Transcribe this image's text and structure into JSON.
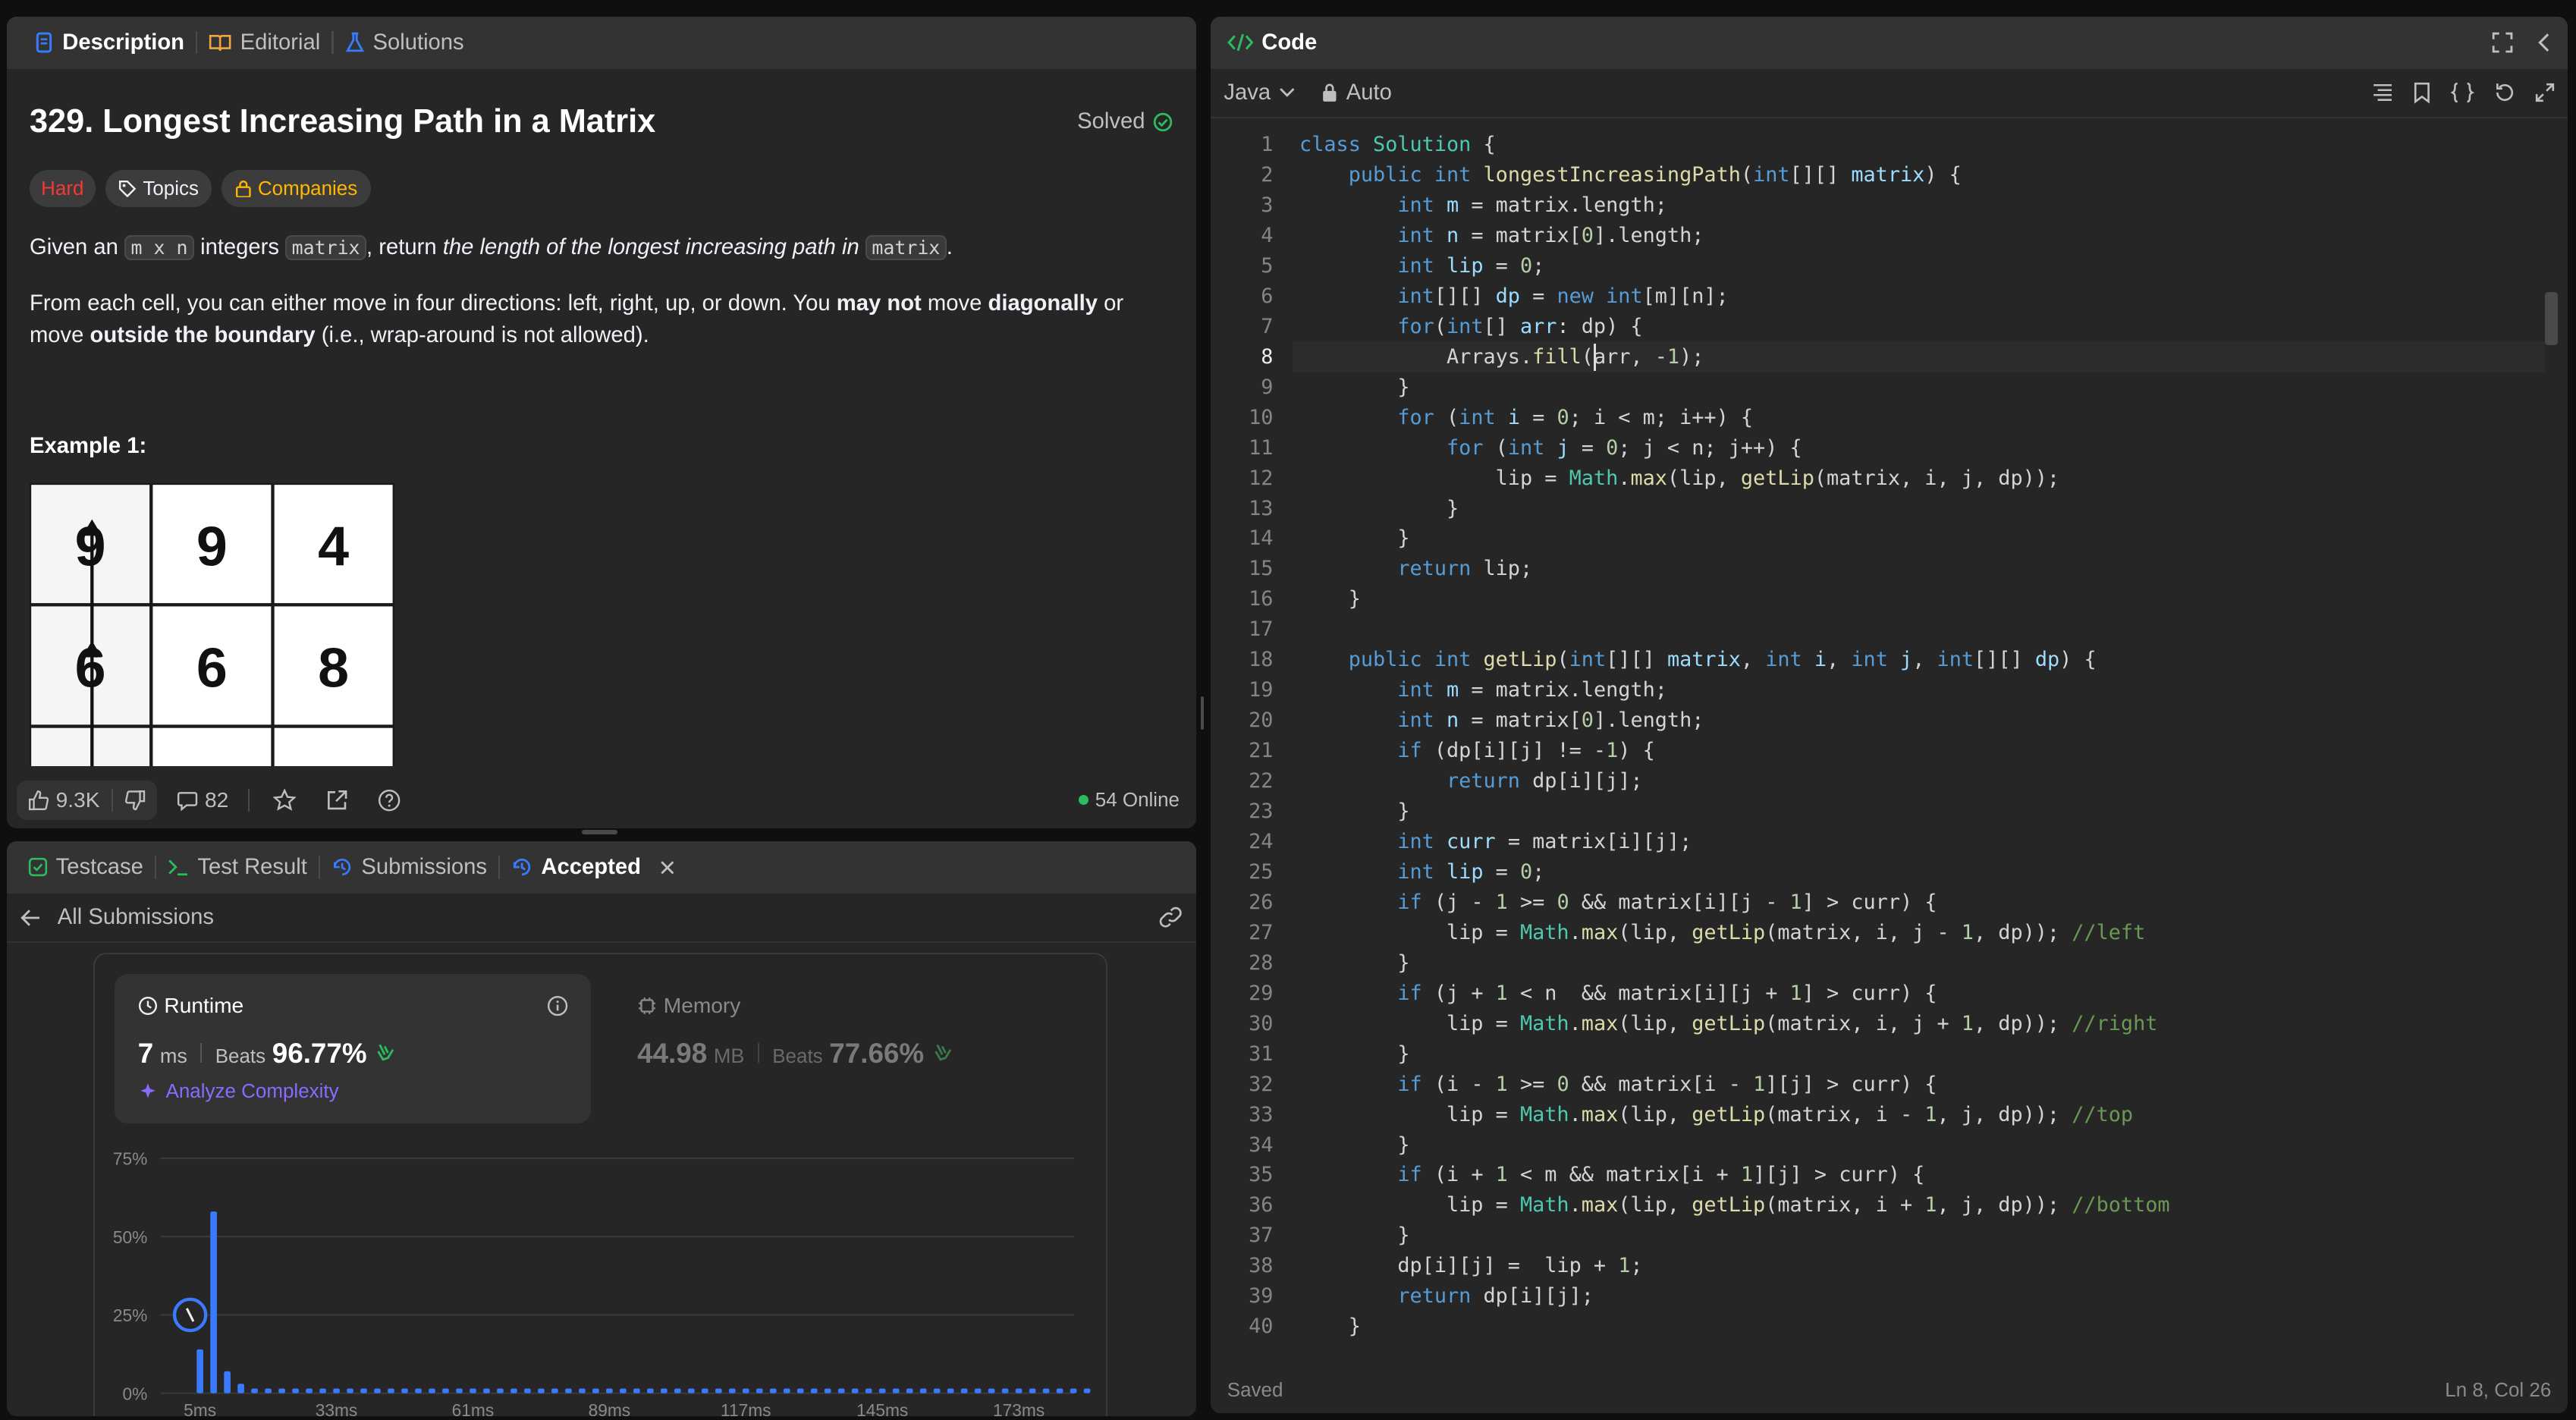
{
  "left_tabs": {
    "description": "Description",
    "editorial": "Editorial",
    "solutions": "Solutions"
  },
  "problem": {
    "title": "329. Longest Increasing Path in a Matrix",
    "solved": "Solved",
    "difficulty": "Hard",
    "topics": "Topics",
    "companies": "Companies",
    "p1_a": "Given an ",
    "p1_code1": "m x n",
    "p1_b": " integers ",
    "p1_code2": "matrix",
    "p1_c": ", return ",
    "p1_em": "the length of the longest increasing path in ",
    "p1_code3": "matrix",
    "p1_d": ".",
    "p2_a": "From each cell, you can either move in four directions: left, right, up, or down. You ",
    "p2_b1": "may not",
    "p2_c": " move ",
    "p2_b2": "diagonally",
    "p2_d": " or move ",
    "p2_b3": "outside the boundary",
    "p2_e": " (i.e., wrap-around is not allowed).",
    "example_heading": "Example 1:",
    "grid": [
      [
        "9",
        "9",
        "4"
      ],
      [
        "6",
        "6",
        "8"
      ]
    ]
  },
  "footer_bar": {
    "likes": "9.3K",
    "comments": "82",
    "online": "54 Online"
  },
  "bottom_tabs": {
    "testcase": "Testcase",
    "test_result": "Test Result",
    "submissions": "Submissions",
    "accepted": "Accepted"
  },
  "submission": {
    "back_label": "All Submissions",
    "runtime_label": "Runtime",
    "runtime_value": "7",
    "runtime_unit": "ms",
    "beats": "Beats",
    "runtime_beats": "96.77%",
    "analyze": "Analyze Complexity",
    "memory_label": "Memory",
    "memory_value": "44.98",
    "memory_unit": "MB",
    "memory_beats": "77.66%"
  },
  "chart_data": {
    "type": "bar",
    "y_ticks": [
      "75%",
      "50%",
      "25%",
      "0%"
    ],
    "x_ticks": [
      "5ms",
      "33ms",
      "61ms",
      "89ms",
      "117ms",
      "145ms",
      "173ms"
    ],
    "ylim": [
      0,
      75
    ],
    "values": [
      14,
      58,
      7,
      3,
      1.5,
      1.5,
      1.5,
      1.5,
      1.5,
      1.5,
      1.5,
      1.5,
      1.5,
      1.5,
      1.5,
      1.5,
      1.5,
      1.5,
      1.5,
      1.5,
      1.5,
      1.5,
      1.5,
      1.5,
      1.5,
      1.5,
      1.5,
      1.5,
      1.5,
      1.5,
      1.5,
      1.5,
      1.5,
      1.5,
      1.5,
      1.5,
      1.5,
      1.5,
      1.5,
      1.5,
      1.5,
      1.5,
      1.5,
      1.5,
      1.5,
      1.5,
      1.5,
      1.5,
      1.5,
      1.5,
      1.5,
      1.5,
      1.5,
      1.5,
      1.5,
      1.5,
      1.5,
      1.5,
      1.5,
      1.5,
      1.5,
      1.5,
      1.5,
      1.5,
      1.5,
      1.5
    ],
    "highlight_index": 0,
    "bar_color": "#3a7bfd"
  },
  "code_panel": {
    "title": "Code",
    "language": "Java",
    "mode": "Auto",
    "status": "Saved",
    "cursor": "Ln 8, Col 26",
    "lines": [
      [
        [
          "kw",
          "class"
        ],
        [
          "pl",
          " "
        ],
        [
          "ty",
          "Solution"
        ],
        [
          "pl",
          " {"
        ]
      ],
      [
        [
          "pl",
          "    "
        ],
        [
          "kw",
          "public"
        ],
        [
          "pl",
          " "
        ],
        [
          "kw",
          "int"
        ],
        [
          "pl",
          " "
        ],
        [
          "fn",
          "longestIncreasingPath"
        ],
        [
          "pl",
          "("
        ],
        [
          "kw",
          "int"
        ],
        [
          "pl",
          "[][] "
        ],
        [
          "va",
          "matrix"
        ],
        [
          "pl",
          ") {"
        ]
      ],
      [
        [
          "pl",
          "        "
        ],
        [
          "kw",
          "int"
        ],
        [
          "pl",
          " "
        ],
        [
          "va",
          "m"
        ],
        [
          "pl",
          " = matrix.length;"
        ]
      ],
      [
        [
          "pl",
          "        "
        ],
        [
          "kw",
          "int"
        ],
        [
          "pl",
          " "
        ],
        [
          "va",
          "n"
        ],
        [
          "pl",
          " = matrix["
        ],
        [
          "nm",
          "0"
        ],
        [
          "pl",
          "].length;"
        ]
      ],
      [
        [
          "pl",
          "        "
        ],
        [
          "kw",
          "int"
        ],
        [
          "pl",
          " "
        ],
        [
          "va",
          "lip"
        ],
        [
          "pl",
          " = "
        ],
        [
          "nm",
          "0"
        ],
        [
          "pl",
          ";"
        ]
      ],
      [
        [
          "pl",
          "        "
        ],
        [
          "kw",
          "int"
        ],
        [
          "pl",
          "[][] "
        ],
        [
          "va",
          "dp"
        ],
        [
          "pl",
          " = "
        ],
        [
          "kw",
          "new"
        ],
        [
          "pl",
          " "
        ],
        [
          "kw",
          "int"
        ],
        [
          "pl",
          "[m][n];"
        ]
      ],
      [
        [
          "pl",
          "        "
        ],
        [
          "kw",
          "for"
        ],
        [
          "pl",
          "("
        ],
        [
          "kw",
          "int"
        ],
        [
          "pl",
          "[] "
        ],
        [
          "va",
          "arr"
        ],
        [
          "pl",
          ": dp) {"
        ]
      ],
      [
        [
          "pl",
          "            Arrays."
        ],
        [
          "fn",
          "fill"
        ],
        [
          "pl",
          "(arr, -"
        ],
        [
          "nm",
          "1"
        ],
        [
          "pl",
          ");"
        ]
      ],
      [
        [
          "pl",
          "        }"
        ]
      ],
      [
        [
          "pl",
          "        "
        ],
        [
          "kw",
          "for"
        ],
        [
          "pl",
          " ("
        ],
        [
          "kw",
          "int"
        ],
        [
          "pl",
          " "
        ],
        [
          "va",
          "i"
        ],
        [
          "pl",
          " = "
        ],
        [
          "nm",
          "0"
        ],
        [
          "pl",
          "; i < m; i++) {"
        ]
      ],
      [
        [
          "pl",
          "            "
        ],
        [
          "kw",
          "for"
        ],
        [
          "pl",
          " ("
        ],
        [
          "kw",
          "int"
        ],
        [
          "pl",
          " "
        ],
        [
          "va",
          "j"
        ],
        [
          "pl",
          " = "
        ],
        [
          "nm",
          "0"
        ],
        [
          "pl",
          "; j < n; j++) {"
        ]
      ],
      [
        [
          "pl",
          "                lip = "
        ],
        [
          "ty",
          "Math"
        ],
        [
          "pl",
          "."
        ],
        [
          "fn",
          "max"
        ],
        [
          "pl",
          "(lip, "
        ],
        [
          "fn",
          "getLip"
        ],
        [
          "pl",
          "(matrix, i, j, dp));"
        ]
      ],
      [
        [
          "pl",
          "            }"
        ]
      ],
      [
        [
          "pl",
          "        }"
        ]
      ],
      [
        [
          "pl",
          "        "
        ],
        [
          "kw",
          "return"
        ],
        [
          "pl",
          " lip;"
        ]
      ],
      [
        [
          "pl",
          "    }"
        ]
      ],
      [
        [
          "pl",
          ""
        ]
      ],
      [
        [
          "pl",
          "    "
        ],
        [
          "kw",
          "public"
        ],
        [
          "pl",
          " "
        ],
        [
          "kw",
          "int"
        ],
        [
          "pl",
          " "
        ],
        [
          "fn",
          "getLip"
        ],
        [
          "pl",
          "("
        ],
        [
          "kw",
          "int"
        ],
        [
          "pl",
          "[][] "
        ],
        [
          "va",
          "matrix"
        ],
        [
          "pl",
          ", "
        ],
        [
          "kw",
          "int"
        ],
        [
          "pl",
          " "
        ],
        [
          "va",
          "i"
        ],
        [
          "pl",
          ", "
        ],
        [
          "kw",
          "int"
        ],
        [
          "pl",
          " "
        ],
        [
          "va",
          "j"
        ],
        [
          "pl",
          ", "
        ],
        [
          "kw",
          "int"
        ],
        [
          "pl",
          "[][] "
        ],
        [
          "va",
          "dp"
        ],
        [
          "pl",
          ") {"
        ]
      ],
      [
        [
          "pl",
          "        "
        ],
        [
          "kw",
          "int"
        ],
        [
          "pl",
          " "
        ],
        [
          "va",
          "m"
        ],
        [
          "pl",
          " = matrix.length;"
        ]
      ],
      [
        [
          "pl",
          "        "
        ],
        [
          "kw",
          "int"
        ],
        [
          "pl",
          " "
        ],
        [
          "va",
          "n"
        ],
        [
          "pl",
          " = matrix["
        ],
        [
          "nm",
          "0"
        ],
        [
          "pl",
          "].length;"
        ]
      ],
      [
        [
          "pl",
          "        "
        ],
        [
          "kw",
          "if"
        ],
        [
          "pl",
          " (dp[i][j] != -"
        ],
        [
          "nm",
          "1"
        ],
        [
          "pl",
          ") {"
        ]
      ],
      [
        [
          "pl",
          "            "
        ],
        [
          "kw",
          "return"
        ],
        [
          "pl",
          " dp[i][j];"
        ]
      ],
      [
        [
          "pl",
          "        }"
        ]
      ],
      [
        [
          "pl",
          "        "
        ],
        [
          "kw",
          "int"
        ],
        [
          "pl",
          " "
        ],
        [
          "va",
          "curr"
        ],
        [
          "pl",
          " = matrix[i][j];"
        ]
      ],
      [
        [
          "pl",
          "        "
        ],
        [
          "kw",
          "int"
        ],
        [
          "pl",
          " "
        ],
        [
          "va",
          "lip"
        ],
        [
          "pl",
          " = "
        ],
        [
          "nm",
          "0"
        ],
        [
          "pl",
          ";"
        ]
      ],
      [
        [
          "pl",
          "        "
        ],
        [
          "kw",
          "if"
        ],
        [
          "pl",
          " (j - "
        ],
        [
          "nm",
          "1"
        ],
        [
          "pl",
          " >= "
        ],
        [
          "nm",
          "0"
        ],
        [
          "pl",
          " && matrix[i][j - "
        ],
        [
          "nm",
          "1"
        ],
        [
          "pl",
          "] > curr) {"
        ]
      ],
      [
        [
          "pl",
          "            lip = "
        ],
        [
          "ty",
          "Math"
        ],
        [
          "pl",
          "."
        ],
        [
          "fn",
          "max"
        ],
        [
          "pl",
          "(lip, "
        ],
        [
          "fn",
          "getLip"
        ],
        [
          "pl",
          "(matrix, i, j - "
        ],
        [
          "nm",
          "1"
        ],
        [
          "pl",
          ", dp)); "
        ],
        [
          "cm",
          "//left"
        ]
      ],
      [
        [
          "pl",
          "        }"
        ]
      ],
      [
        [
          "pl",
          "        "
        ],
        [
          "kw",
          "if"
        ],
        [
          "pl",
          " (j + "
        ],
        [
          "nm",
          "1"
        ],
        [
          "pl",
          " < n  && matrix[i][j + "
        ],
        [
          "nm",
          "1"
        ],
        [
          "pl",
          "] > curr) {"
        ]
      ],
      [
        [
          "pl",
          "            lip = "
        ],
        [
          "ty",
          "Math"
        ],
        [
          "pl",
          "."
        ],
        [
          "fn",
          "max"
        ],
        [
          "pl",
          "(lip, "
        ],
        [
          "fn",
          "getLip"
        ],
        [
          "pl",
          "(matrix, i, j + "
        ],
        [
          "nm",
          "1"
        ],
        [
          "pl",
          ", dp)); "
        ],
        [
          "cm",
          "//right"
        ]
      ],
      [
        [
          "pl",
          "        }"
        ]
      ],
      [
        [
          "pl",
          "        "
        ],
        [
          "kw",
          "if"
        ],
        [
          "pl",
          " (i - "
        ],
        [
          "nm",
          "1"
        ],
        [
          "pl",
          " >= "
        ],
        [
          "nm",
          "0"
        ],
        [
          "pl",
          " && matrix[i - "
        ],
        [
          "nm",
          "1"
        ],
        [
          "pl",
          "][j] > curr) {"
        ]
      ],
      [
        [
          "pl",
          "            lip = "
        ],
        [
          "ty",
          "Math"
        ],
        [
          "pl",
          "."
        ],
        [
          "fn",
          "max"
        ],
        [
          "pl",
          "(lip, "
        ],
        [
          "fn",
          "getLip"
        ],
        [
          "pl",
          "(matrix, i - "
        ],
        [
          "nm",
          "1"
        ],
        [
          "pl",
          ", j, dp)); "
        ],
        [
          "cm",
          "//top"
        ]
      ],
      [
        [
          "pl",
          "        }"
        ]
      ],
      [
        [
          "pl",
          "        "
        ],
        [
          "kw",
          "if"
        ],
        [
          "pl",
          " (i + "
        ],
        [
          "nm",
          "1"
        ],
        [
          "pl",
          " < m && matrix[i + "
        ],
        [
          "nm",
          "1"
        ],
        [
          "pl",
          "][j] > curr) {"
        ]
      ],
      [
        [
          "pl",
          "            lip = "
        ],
        [
          "ty",
          "Math"
        ],
        [
          "pl",
          "."
        ],
        [
          "fn",
          "max"
        ],
        [
          "pl",
          "(lip, "
        ],
        [
          "fn",
          "getLip"
        ],
        [
          "pl",
          "(matrix, i + "
        ],
        [
          "nm",
          "1"
        ],
        [
          "pl",
          ", j, dp)); "
        ],
        [
          "cm",
          "//bottom"
        ]
      ],
      [
        [
          "pl",
          "        }"
        ]
      ],
      [
        [
          "pl",
          "        dp[i][j] =  lip + "
        ],
        [
          "nm",
          "1"
        ],
        [
          "pl",
          ";"
        ]
      ],
      [
        [
          "pl",
          "        "
        ],
        [
          "kw",
          "return"
        ],
        [
          "pl",
          " dp[i][j];"
        ]
      ],
      [
        [
          "pl",
          "    }"
        ]
      ]
    ]
  }
}
